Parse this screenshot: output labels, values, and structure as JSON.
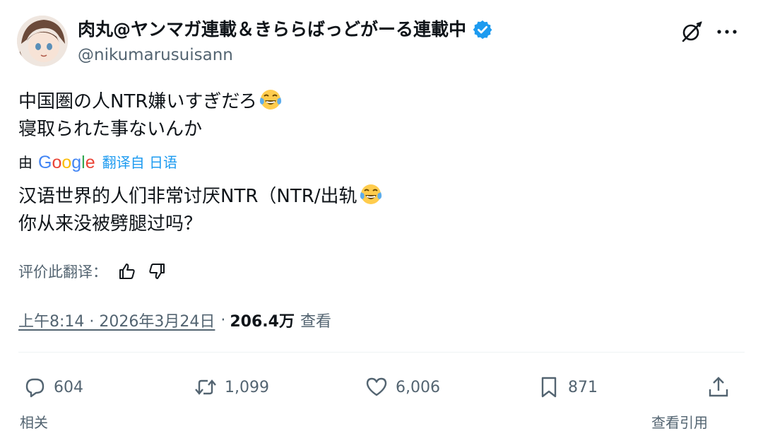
{
  "author": {
    "display_name": "肉丸@ヤンマガ連載＆きららばっどがーる連載中",
    "handle": "@nikumarusuisann",
    "verified": true,
    "verified_color": "#1d9bf0"
  },
  "tweet": {
    "original_lines": [
      "中国圏の人NTR嫌いすぎだろ",
      "寝取られた事ないんか"
    ],
    "emoji": "face-with-tears-of-joy"
  },
  "translation": {
    "by_label": "由",
    "provider_letters": [
      "G",
      "o",
      "o",
      "g",
      "l",
      "e"
    ],
    "source_label": "翻译自 日语",
    "lines": [
      "汉语世界的人们非常讨厌NTR（NTR/出轨",
      "你从来没被劈腿过吗？"
    ],
    "rate_label": "评价此翻译："
  },
  "meta": {
    "time": "上午8:14 · 2026年3月24日",
    "separator": "·",
    "views_count": "206.4万",
    "views_label": "查看"
  },
  "actions": {
    "replies": "604",
    "reposts": "1,099",
    "likes": "6,006",
    "bookmarks": "871"
  },
  "clipped_bottom": {
    "left": "相关",
    "right": "查看引用"
  },
  "colors": {
    "text": "#0f1419",
    "muted": "#536471",
    "link": "#1d9bf0"
  }
}
